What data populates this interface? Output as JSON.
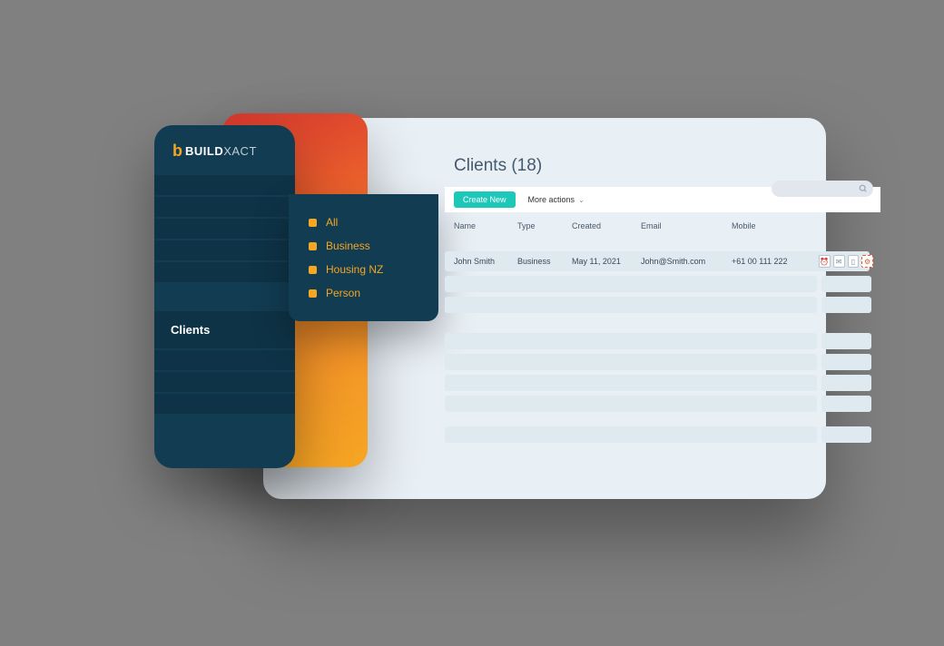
{
  "brand": {
    "name_bold": "BUILD",
    "name_light": "XACT"
  },
  "sidebar": {
    "active_label": "Clients"
  },
  "submenu": {
    "items": [
      {
        "label": "All"
      },
      {
        "label": "Business"
      },
      {
        "label": "Housing NZ"
      },
      {
        "label": "Person"
      }
    ]
  },
  "page": {
    "title": "Clients (18)",
    "count": 18
  },
  "toolbar": {
    "create_label": "Create New",
    "more_actions_label": "More actions"
  },
  "table": {
    "columns": {
      "name": "Name",
      "type": "Type",
      "created": "Created",
      "email": "Email",
      "mobile": "Mobile"
    },
    "rows": [
      {
        "name": "John Smith",
        "type": "Business",
        "created": "May 11, 2021",
        "email": "John@Smith.com",
        "mobile": "+61 00 111 222"
      }
    ]
  }
}
